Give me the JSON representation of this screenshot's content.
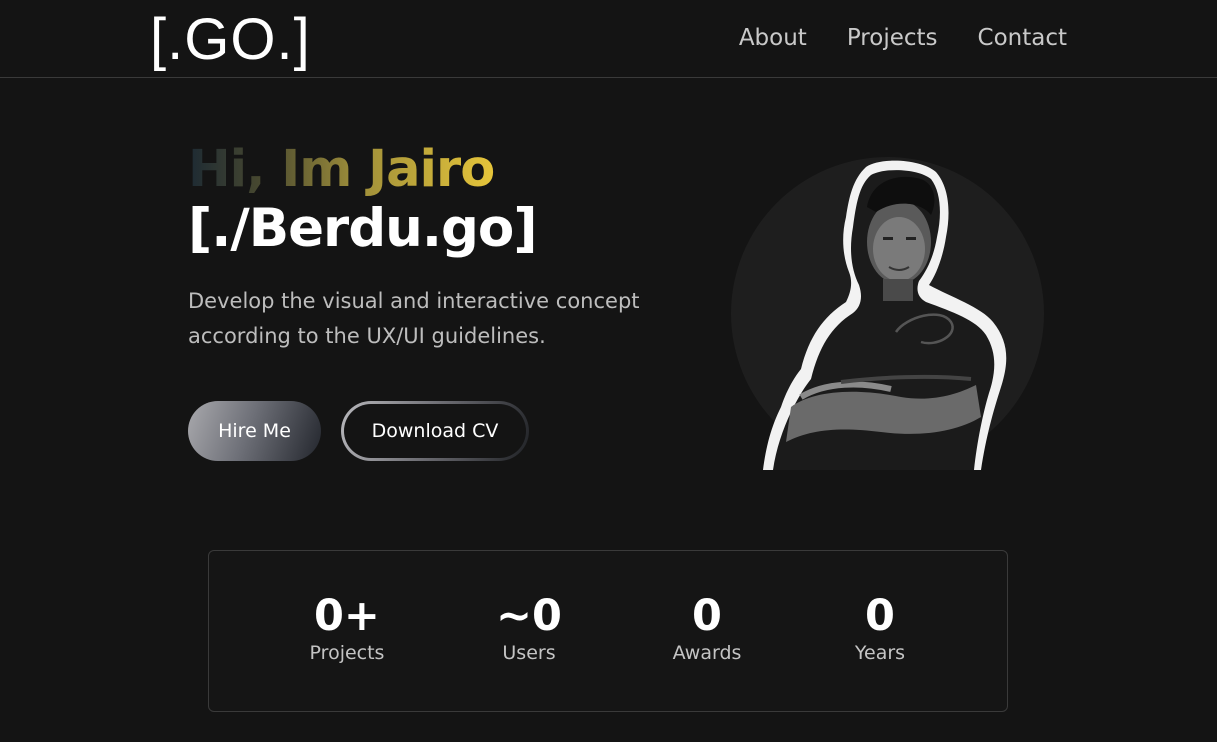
{
  "header": {
    "logo": "[.GO.]",
    "nav": [
      {
        "label": "About"
      },
      {
        "label": "Projects"
      },
      {
        "label": "Contact"
      }
    ]
  },
  "hero": {
    "greeting": "Hi, Im Jairo",
    "handle": "[./Berdu.go]",
    "tagline_line1": "Develop the visual and interactive concept",
    "tagline_line2": "according to the UX/UI guidelines.",
    "hire_label": "Hire Me",
    "cv_label": "Download CV",
    "greeting_gradient": [
      "#1d2a33",
      "#9e8e3a",
      "#e6c53a"
    ]
  },
  "stats": [
    {
      "value": "0+",
      "label": "Projects"
    },
    {
      "value": "~0",
      "label": "Users"
    },
    {
      "value": "0",
      "label": "Awards"
    },
    {
      "value": "0",
      "label": "Years"
    }
  ],
  "colors": {
    "background": "#141414",
    "text_primary": "#ffffff",
    "text_secondary": "#c4c4c4",
    "border": "#3a3a3a"
  }
}
